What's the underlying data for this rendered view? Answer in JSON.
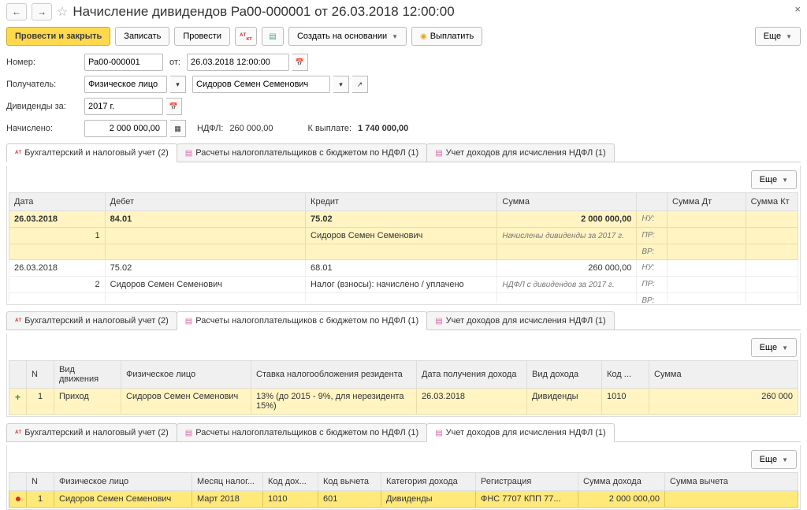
{
  "nav": {
    "title": "Начисление дивидендов Ра00-000001 от 26.03.2018 12:00:00"
  },
  "toolbar": {
    "post_close": "Провести и закрыть",
    "save": "Записать",
    "post": "Провести",
    "create_based": "Создать на основании",
    "pay": "Выплатить",
    "more": "Еще"
  },
  "form": {
    "number_lbl": "Номер:",
    "number": "Ра00-000001",
    "from_lbl": "от:",
    "date": "26.03.2018 12:00:00",
    "recipient_lbl": "Получатель:",
    "recipient_type": "Физическое лицо",
    "recipient": "Сидоров Семен Семенович",
    "div_for_lbl": "Дивиденды за:",
    "div_year": "2017 г.",
    "accrued_lbl": "Начислено:",
    "accrued": "2 000 000,00",
    "ndfl_lbl": "НДФЛ:",
    "ndfl": "260 000,00",
    "topay_lbl": "К выплате:",
    "topay": "1 740 000,00"
  },
  "tabs": {
    "t1": "Бухгалтерский и налоговый учет (2)",
    "t2": "Расчеты налогоплательщиков с бюджетом по НДФЛ (1)",
    "t3": "Учет доходов для исчисления НДФЛ (1)"
  },
  "table1": {
    "headers": {
      "date": "Дата",
      "debit": "Дебет",
      "credit": "Кредит",
      "sum": "Сумма",
      "sum_dt": "Сумма Дт",
      "sum_kt": "Сумма Кт"
    },
    "rows": [
      {
        "date": "26.03.2018",
        "debit": "84.01",
        "credit": "75.02",
        "sum": "2 000 000,00",
        "n": "1",
        "credit2": "Сидоров Семен Семенович",
        "note": "Начислены дивиденды за 2017 г.",
        "nu": "НУ:",
        "pr": "ПР:",
        "vr": "ВР:"
      },
      {
        "date": "26.03.2018",
        "debit": "75.02",
        "credit": "68.01",
        "sum": "260 000,00",
        "n": "2",
        "debit2": "Сидоров Семен Семенович",
        "credit2": "Налог (взносы): начислено / уплачено",
        "note": "НДФЛ с дивидендов за 2017 г.",
        "nu": "НУ:",
        "pr": "ПР:",
        "vr": "ВР:"
      }
    ]
  },
  "table2": {
    "headers": {
      "n": "N",
      "move": "Вид движения",
      "person": "Физическое лицо",
      "rate": "Ставка налогообложения резидента",
      "income_date": "Дата получения дохода",
      "income_type": "Вид дохода",
      "code": "Код ...",
      "sum": "Сумма"
    },
    "rows": [
      {
        "n": "1",
        "move": "Приход",
        "person": "Сидоров Семен Семенович",
        "rate": "13% (до 2015 - 9%, для нерезидента 15%)",
        "income_date": "26.03.2018",
        "income_type": "Дивиденды",
        "code": "1010",
        "sum": "260 000"
      }
    ]
  },
  "table3": {
    "headers": {
      "n": "N",
      "person": "Физическое лицо",
      "month": "Месяц налог...",
      "code_inc": "Код дох...",
      "code_ded": "Код вычета",
      "category": "Категория дохода",
      "reg": "Регистрация",
      "sum_inc": "Сумма дохода",
      "sum_ded": "Сумма вычета"
    },
    "rows": [
      {
        "n": "1",
        "person": "Сидоров Семен Семенович",
        "month": "Март 2018",
        "code_inc": "1010",
        "code_ded": "601",
        "category": "Дивиденды",
        "reg": "ФНС 7707 КПП 77...",
        "sum_inc": "2 000 000,00",
        "sum_ded": ""
      }
    ]
  }
}
